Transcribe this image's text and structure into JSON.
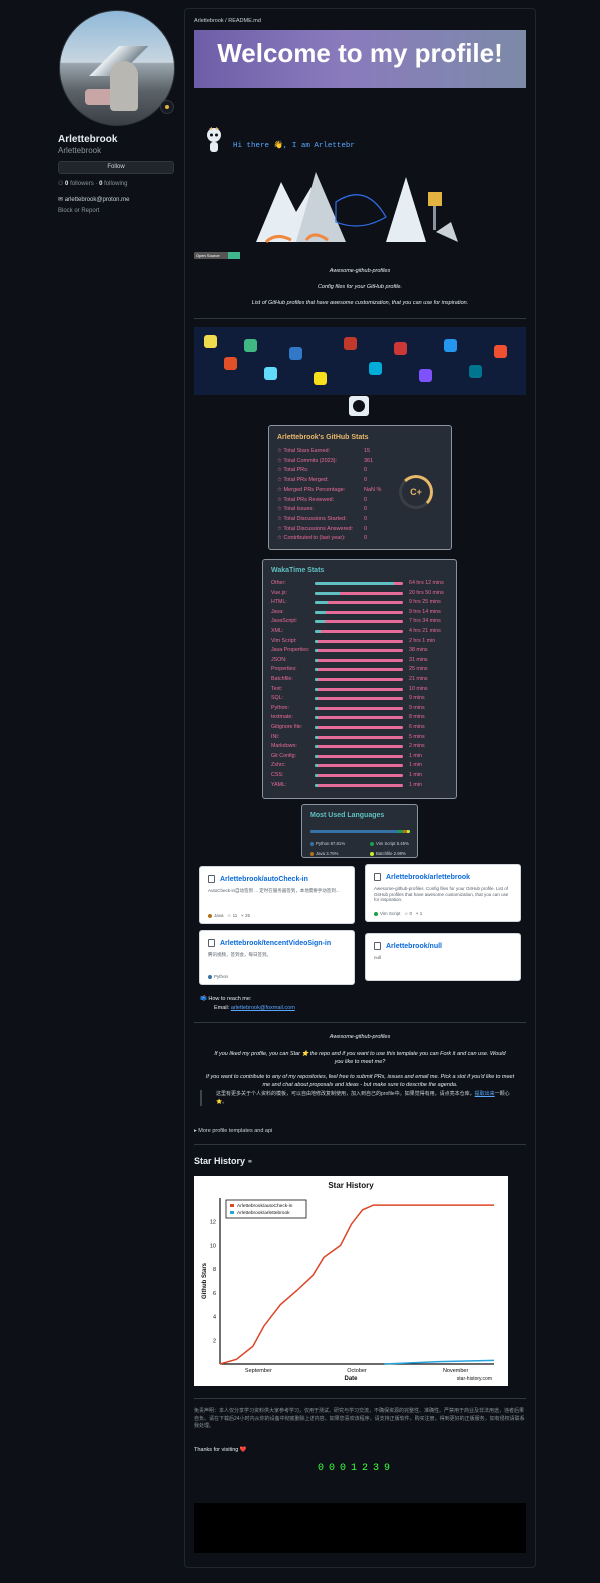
{
  "profile": {
    "name": "Arlettebrook",
    "login": "Arlettebrook",
    "follow_label": "Follow",
    "followers_count": "0",
    "followers_label": "followers",
    "following_count": "0",
    "following_label": "following",
    "email": "arlettebrook@proton.me",
    "block_label": "Block or Report"
  },
  "readme": {
    "path": "Arlettebrook / README.md",
    "banner": "Welcome to my profile!",
    "typing": "Hi there 👋, I am Arlettebr",
    "badge": "Open Source",
    "awesome_title": "Awesome-github-profiles",
    "config_line": "Config files for your GitHub profile.",
    "list_line": "List of GitHub profiles that have awesome customization, that you can use for inspiration."
  },
  "github_stats": {
    "title": "Arlettebrook's GitHub Stats",
    "grade": "C+",
    "rows": [
      {
        "label": "Total Stars Earned:",
        "value": "15"
      },
      {
        "label": "Total Commits (2023):",
        "value": "361"
      },
      {
        "label": "Total PRs:",
        "value": "0"
      },
      {
        "label": "Total PRs Merged:",
        "value": "0"
      },
      {
        "label": "Merged PRs Percentage:",
        "value": "NaN %"
      },
      {
        "label": "Total PRs Reviewed:",
        "value": "0"
      },
      {
        "label": "Total Issues:",
        "value": "0"
      },
      {
        "label": "Total Discussions Started:",
        "value": "0"
      },
      {
        "label": "Total Discussions Answered:",
        "value": "0"
      },
      {
        "label": "Contributed to (last year):",
        "value": "0"
      }
    ]
  },
  "wakatime": {
    "title": "WakaTime Stats",
    "rows": [
      {
        "label": "Other:",
        "time": "64 hrs 12 mins",
        "pct": 0.5
      },
      {
        "label": "Vue.js:",
        "time": "20 hrs 50 mins",
        "pct": 0.16
      },
      {
        "label": "HTML:",
        "time": "9 hrs 25 mins",
        "pct": 0.08
      },
      {
        "label": "Java:",
        "time": "9 hrs 14 mins",
        "pct": 0.07
      },
      {
        "label": "JavaScript:",
        "time": "7 hrs 34 mins",
        "pct": 0.06
      },
      {
        "label": "XML:",
        "time": "4 hrs 21 mins",
        "pct": 0.035
      },
      {
        "label": "Vim Script:",
        "time": "2 hrs 1 min",
        "pct": 0.016
      },
      {
        "label": "Java Properties:",
        "time": "38 mins",
        "pct": 0.006
      },
      {
        "label": "JSON:",
        "time": "31 mins",
        "pct": 0.005
      },
      {
        "label": "Properties:",
        "time": "25 mins",
        "pct": 0.004
      },
      {
        "label": "Batchfile:",
        "time": "21 mins",
        "pct": 0.003
      },
      {
        "label": "Text:",
        "time": "10 mins",
        "pct": 0.002
      },
      {
        "label": "SQL:",
        "time": "9 mins",
        "pct": 0.002
      },
      {
        "label": "Python:",
        "time": "9 mins",
        "pct": 0.002
      },
      {
        "label": "textmate:",
        "time": "8 mins",
        "pct": 0.001
      },
      {
        "label": "Gitignore file:",
        "time": "6 mins",
        "pct": 0.001
      },
      {
        "label": "INI:",
        "time": "5 mins",
        "pct": 0.001
      },
      {
        "label": "Markdown:",
        "time": "2 mins",
        "pct": 0.001
      },
      {
        "label": "Git Config:",
        "time": "1 min",
        "pct": 0.001
      },
      {
        "label": "Zshrc:",
        "time": "1 min",
        "pct": 0.001
      },
      {
        "label": "CSS:",
        "time": "1 min",
        "pct": 0.001
      },
      {
        "label": "YAML:",
        "time": "1 min",
        "pct": 0.001
      }
    ]
  },
  "languages": {
    "title": "Most Used Languages",
    "items": [
      {
        "name": "Python 87.81%",
        "color": "#3572a5",
        "pct": 87.81
      },
      {
        "name": "Vim Script 5.45%",
        "color": "#199f4b",
        "pct": 5.45
      },
      {
        "name": "Java 3.76%",
        "color": "#b07219",
        "pct": 3.76
      },
      {
        "name": "Batchfile 2.98%",
        "color": "#c1f12e",
        "pct": 2.98
      }
    ]
  },
  "pins": [
    {
      "title": "Arlettebrook/autoCheck-in",
      "desc": "AutoCheck-in自动签到 ... 定时在服务器签到，本地需要手动签到...",
      "lang": "Java",
      "lang_color": "#b07219",
      "stars": "11",
      "forks": "25"
    },
    {
      "title": "Arlettebrook/arlettebrook",
      "desc": "Awesome-github-profiles. Config files for your GitHub profile. List of GitHub profiles that have awesome customization, that you can use for inspiration.",
      "lang": "Vim Script",
      "lang_color": "#199f4b",
      "stars": "0",
      "forks": "1"
    },
    {
      "title": "Arlettebrook/tencentVideoSign-in",
      "desc": "腾讯视频，签到会，每日签到。",
      "lang": "Python",
      "lang_color": "#3572a5",
      "stars": "",
      "forks": ""
    },
    {
      "title": "Arlettebrook/null",
      "desc": "null",
      "lang": "",
      "lang_color": "",
      "stars": "",
      "forks": ""
    }
  ],
  "reach": {
    "heading": "📫 How to reach me:",
    "email_label": "Email:",
    "email_value": "arlettebrook@foxmail.com"
  },
  "outro": {
    "title": "Awesome-github-profiles",
    "p1": "If you liked my profile, you can Star ⭐ the repo and if you want to use this template you can Fork it and can use. Would you like to meet me?",
    "p2": "If you want to contribute to any of my repositories, feel free to submit PRs, issues and email me. Pick a slot if you'd like to meet me and chat about proposals and ideas - but make sure to describe the agenda.",
    "note": "这里有更多关于个人资料的模板，可以自由地修改复制使用，加入到自己的profile中。如果觉得有用，请点亮本仓库，",
    "note_link": "提取出来",
    "note_end": "一颗心⭐。",
    "more": "▸ More profile templates and api"
  },
  "star_history": {
    "heading": "Star History",
    "credit": "star-history.com"
  },
  "chart_data": {
    "type": "line",
    "title": "Star History",
    "xlabel": "Date",
    "ylabel": "Github Stars",
    "x_ticks": [
      "September",
      "October",
      "November"
    ],
    "y_ticks": [
      2,
      4,
      6,
      8,
      10,
      12
    ],
    "ylim": [
      0,
      14
    ],
    "legend_position": "top-left",
    "series": [
      {
        "name": "Arlettebrook/autoCheck-in",
        "color": "#dd4528",
        "points": [
          [
            0,
            0
          ],
          [
            0.06,
            0.4
          ],
          [
            0.12,
            1.5
          ],
          [
            0.16,
            3.2
          ],
          [
            0.22,
            5
          ],
          [
            0.28,
            6.2
          ],
          [
            0.34,
            7.5
          ],
          [
            0.38,
            9
          ],
          [
            0.44,
            10
          ],
          [
            0.48,
            11.8
          ],
          [
            0.52,
            13
          ],
          [
            0.56,
            13.4
          ],
          [
            1,
            13.4
          ]
        ]
      },
      {
        "name": "Arlettebrook/arlettebrook",
        "color": "#28a3dd",
        "points": [
          [
            0.6,
            0
          ],
          [
            0.8,
            0.2
          ],
          [
            1,
            0.3
          ]
        ]
      }
    ]
  },
  "footer": {
    "disclaimer": "免责声明：本人仅分享学习资料供大家参考学习，仅用于测试、研究与学习交流，不确保资源的完整性、准确性。严禁用于商业及非法用途，违者后果自负。请在下载后24小时内从你的设备中彻底删除上述内容。如果您喜欢该程序，请支持正版软件，购买注册，得到更好的正版服务。如有侵权请联系我处理。",
    "thanks": "Thanks for visiting ❤️",
    "counter": "0001239"
  }
}
